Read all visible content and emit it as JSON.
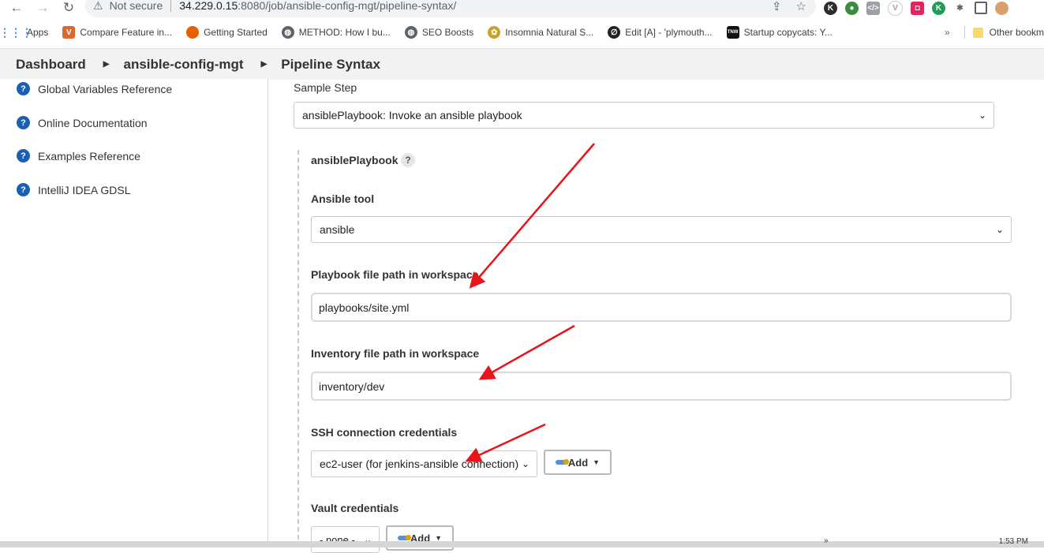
{
  "browser": {
    "security_label": "Not secure",
    "url_host": "34.229.0.15",
    "url_path": ":8080/job/ansible-config-mgt/pipeline-syntax/"
  },
  "bookmarks": {
    "items": [
      {
        "label": "Apps",
        "icon": "apps-grid-icon",
        "color": "#4285f4"
      },
      {
        "label": "Compare Feature in...",
        "icon": "v-logo-icon",
        "color": "#d9692f"
      },
      {
        "label": "Getting Started",
        "icon": "firefox-icon",
        "color": "#e66000"
      },
      {
        "label": "METHOD: How I bu...",
        "icon": "globe-icon",
        "color": "#5f6368"
      },
      {
        "label": "SEO Boosts",
        "icon": "globe-icon",
        "color": "#5f6368"
      },
      {
        "label": "Insomnia Natural S...",
        "icon": "bee-icon",
        "color": "#c9a227"
      },
      {
        "label": "Edit [A] - 'plymouth...",
        "icon": "editor-icon",
        "color": "#222222"
      },
      {
        "label": "Startup copycats: Y...",
        "icon": "tnw-icon",
        "color": "#111111"
      }
    ],
    "overflow": "»",
    "other": "Other bookm"
  },
  "breadcrumb": {
    "items": [
      "Dashboard",
      "ansible-config-mgt",
      "Pipeline Syntax"
    ]
  },
  "sidebar": {
    "items": [
      {
        "label": "Global Variables Reference"
      },
      {
        "label": "Online Documentation"
      },
      {
        "label": "Examples Reference"
      },
      {
        "label": "IntelliJ IDEA GDSL"
      }
    ]
  },
  "form": {
    "sample_step_label": "Sample Step",
    "sample_step_value": "ansiblePlaybook: Invoke an ansible playbook",
    "section_title": "ansiblePlaybook",
    "help_glyph": "?",
    "ansible_tool_label": "Ansible tool",
    "ansible_tool_value": "ansible",
    "playbook_label": "Playbook file path in workspace",
    "playbook_value": "playbooks/site.yml",
    "inventory_label": "Inventory file path in workspace",
    "inventory_value": "inventory/dev",
    "ssh_label": "SSH connection credentials",
    "ssh_value": "ec2-user (for jenkins-ansible connection)",
    "add_label": "Add",
    "vault_label": "Vault credentials",
    "vault_value": "- none -"
  },
  "taskbar": {
    "overflow": "»",
    "clock": "1:53 PM"
  },
  "colors": {
    "annotation_arrow": "#e8141c",
    "help_icon": "#1a5fb4"
  }
}
